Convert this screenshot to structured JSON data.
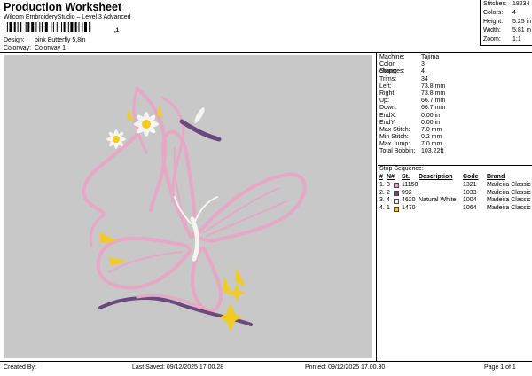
{
  "header": {
    "title": "Production Worksheet",
    "subtitle": "Wilcom EmbroideryStudio – Level 3 Advanced",
    "barcode_text": ",1",
    "design_label": "Design:",
    "design_value": "pink Butterfly 5,8in",
    "colorway_label": "Colorway:",
    "colorway_value": "Colorway 1"
  },
  "summary": [
    {
      "label": "Stitches:",
      "value": "18234"
    },
    {
      "label": "Colors:",
      "value": "4"
    },
    {
      "label": "Height:",
      "value": "5.25 in"
    },
    {
      "label": "Width:",
      "value": "5.81 in"
    },
    {
      "label": "Zoom:",
      "value": "1:1"
    }
  ],
  "stats": [
    {
      "label": "Machine:",
      "value": "Tajima"
    },
    {
      "label": "Color changes:",
      "value": "3"
    },
    {
      "label": "Stops:",
      "value": "4"
    },
    {
      "label": "Trims:",
      "value": "34"
    },
    {
      "label": "Left:",
      "value": "73.8 mm"
    },
    {
      "label": "Right:",
      "value": "73.8 mm"
    },
    {
      "label": "Up:",
      "value": "66.7 mm"
    },
    {
      "label": "Down:",
      "value": "66.7 mm"
    },
    {
      "label": "EndX:",
      "value": "0.00 in"
    },
    {
      "label": "EndY:",
      "value": "0.00 in"
    },
    {
      "label": "Max Stitch:",
      "value": "7.0 mm"
    },
    {
      "label": "Min Stitch:",
      "value": "0.2 mm"
    },
    {
      "label": "Max Jump:",
      "value": "7.0 mm"
    },
    {
      "label": "Total Bobbin:",
      "value": "103.22ft"
    }
  ],
  "stop_sequence": {
    "title": "Stop Sequence:",
    "headers": {
      "num": "#",
      "n": "N#",
      "st": "St.",
      "desc": "Description",
      "code": "Code",
      "brand": "Brand"
    },
    "rows": [
      {
        "num": "1.",
        "n": "3",
        "color": "#e6a8c4",
        "st": "11150",
        "desc": "",
        "code": "1321",
        "brand": "Madeira Classic 40"
      },
      {
        "num": "2.",
        "n": "2",
        "color": "#6a4a7e",
        "st": "992",
        "desc": "",
        "code": "1033",
        "brand": "Madeira Classic 40"
      },
      {
        "num": "3.",
        "n": "4",
        "color": "#f4f4f0",
        "st": "4620",
        "desc": "Natural White",
        "code": "1004",
        "brand": "Madeira Classic 40"
      },
      {
        "num": "4.",
        "n": "1",
        "color": "#f2cc20",
        "st": "1470",
        "desc": "",
        "code": "1064",
        "brand": "Madeira Classic 40"
      }
    ]
  },
  "footer": {
    "created_by": "Created By:",
    "last_saved": "Last Saved: 09/12/2025 17.00.28",
    "printed": "Printed: 09/12/2025 17.00.30",
    "page": "Page 1 of 1"
  },
  "colors": {
    "design_background": "#c8c8c8",
    "pink_thread": "#e6a8c4",
    "purple_thread": "#6a4a7e",
    "white_thread": "#f4f4f0",
    "yellow_thread": "#f2cc20"
  }
}
